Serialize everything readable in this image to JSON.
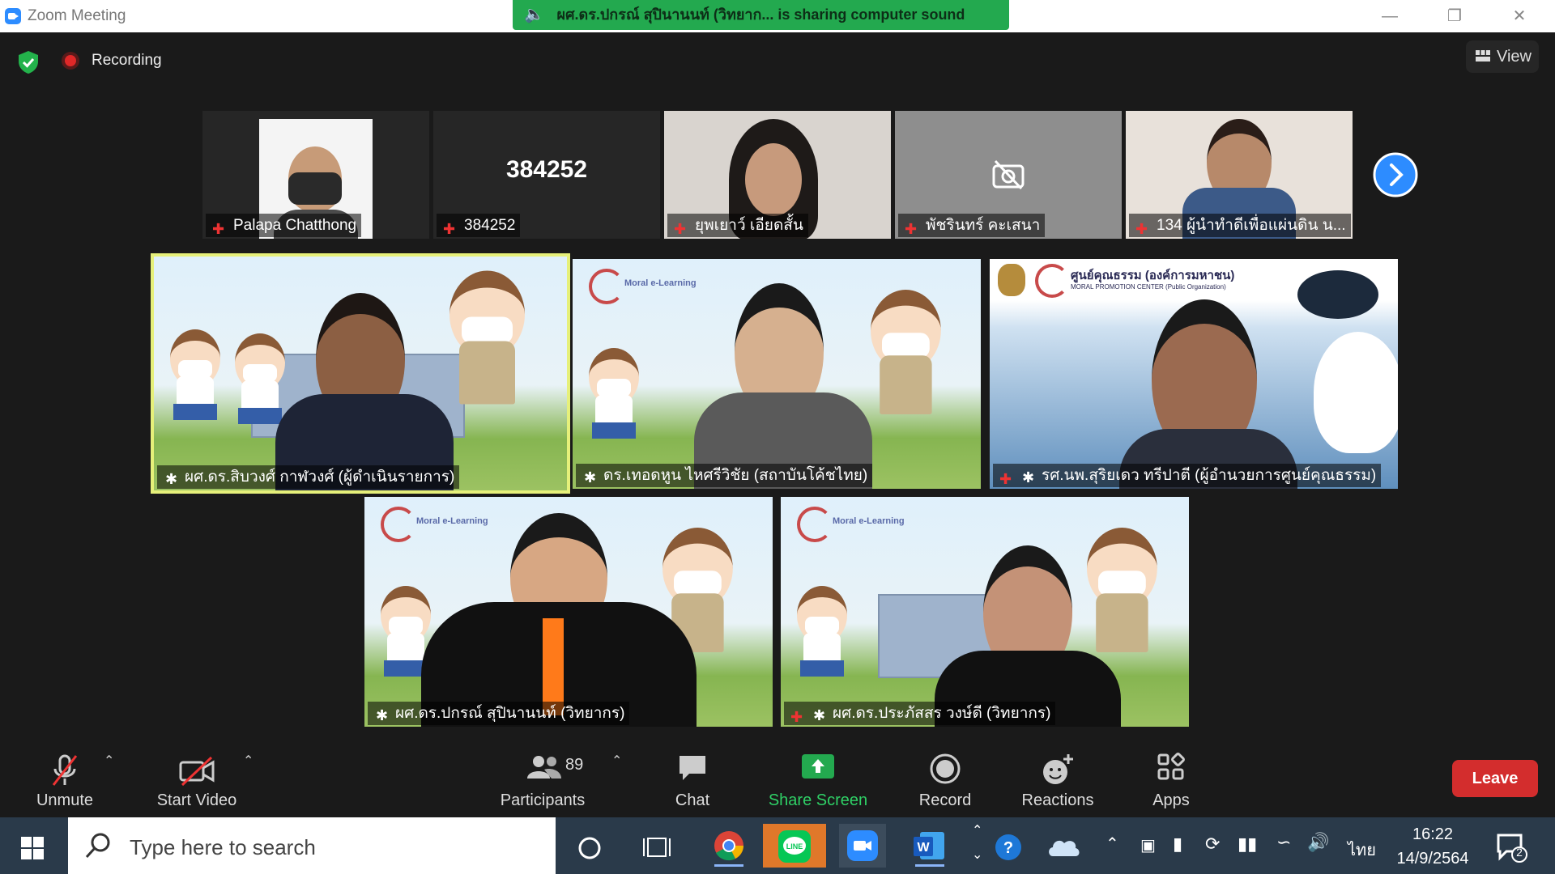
{
  "window": {
    "title": "Zoom Meeting"
  },
  "banner": {
    "text": "ผศ.ดร.ปกรณ์ สุปินานนท์ (วิทยาก... is sharing computer sound"
  },
  "meeting": {
    "recording_label": "Recording",
    "view_label": "View"
  },
  "small_tiles": [
    {
      "name": "Palapa Chatthong",
      "muted": true
    },
    {
      "name": "384252",
      "display_text": "384252",
      "muted": true
    },
    {
      "name": "ยุพเยาว์ เอียดสั้น",
      "muted": true
    },
    {
      "name": "พัชรินทร์ คะเสนา",
      "muted": true
    },
    {
      "name": "134 ผู้นำทำดีเพื่อแผ่นดิน น...",
      "muted": true
    }
  ],
  "large_tiles": [
    {
      "name": "ผศ.ดร.สิบวงศ์ กาฬวงศ์ (ผู้ดำเนินรายการ)",
      "active_speaker": true
    },
    {
      "name": "ดร.เทอดหูน ไหศรีวิชัย (สถาบันโค้ชไทย)"
    },
    {
      "name": "รศ.นพ.สุริยเดว ทรีปาตี (ผู้อำนวยการศูนย์คุณธรรม)",
      "muted": true,
      "bg_title": "ศูนย์คุณธรรม (องค์การมหาชน)",
      "bg_sub": "MORAL PROMOTION CENTER (Public Organization)"
    },
    {
      "name": "ผศ.ดร.ปกรณ์ สุปินานนท์ (วิทยากร)"
    },
    {
      "name": "ผศ.ดร.ประภัสสร วงษ์ดี (วิทยากร)",
      "muted": true
    }
  ],
  "backdrop": {
    "logo_text": "Moral e-Learning"
  },
  "toolbar": {
    "unmute": "Unmute",
    "start_video": "Start Video",
    "participants": "Participants",
    "participants_count": "89",
    "chat": "Chat",
    "share_screen": "Share Screen",
    "record": "Record",
    "reactions": "Reactions",
    "apps": "Apps",
    "leave": "Leave"
  },
  "taskbar": {
    "search_placeholder": "Type here to search",
    "language": "ไทย",
    "time": "16:22",
    "date": "14/9/2564",
    "notification_count": "2"
  },
  "colors": {
    "share_green": "#23a94f",
    "leave_red": "#d32d2d",
    "speaker_highlight": "#e6f07a",
    "zoom_blue": "#2d8cff"
  }
}
